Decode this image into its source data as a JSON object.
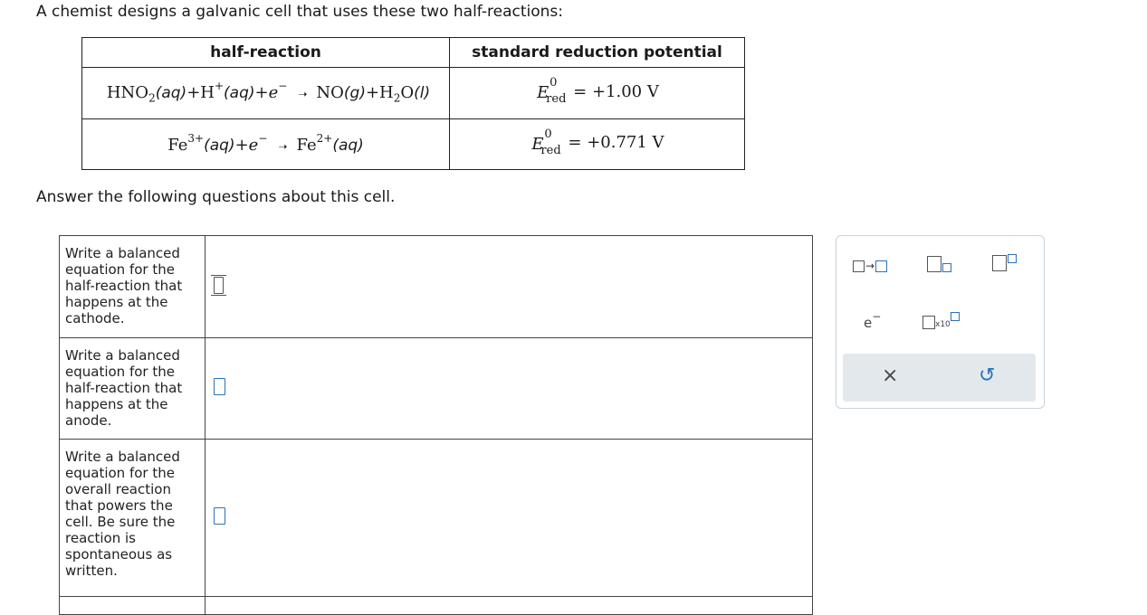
{
  "intro": "A chemist designs a galvanic cell that uses these two half-reactions:",
  "table": {
    "header_reaction": "half-reaction",
    "header_potential": "standard reduction potential",
    "rows": [
      {
        "reaction": "HNO2(aq)+H+(aq)+e− → NO(g)+H2O(l)",
        "potential_value": "= +1.00 V"
      },
      {
        "reaction": "Fe3+(aq)+e− → Fe2+(aq)",
        "potential_value": "= +0.771 V"
      }
    ],
    "potential_symbol": "E",
    "potential_superscript": "0",
    "potential_subscript": "red"
  },
  "answer_intro": "Answer the following questions about this cell.",
  "questions": [
    "Write a balanced equation for the half-reaction that happens at the cathode.",
    "Write a balanced equation for the half-reaction that happens at the anode.",
    "Write a balanced equation for the overall reaction that powers the cell. Be sure the reaction is spontaneous as written."
  ],
  "toolbox": {
    "electron_label": "e",
    "sci_label": "x10",
    "clear_symbol": "×",
    "undo_symbol": "↺"
  },
  "colors": {
    "accent_blue": "#2a72b8",
    "toolbar_gray": "#e3e8ed"
  }
}
